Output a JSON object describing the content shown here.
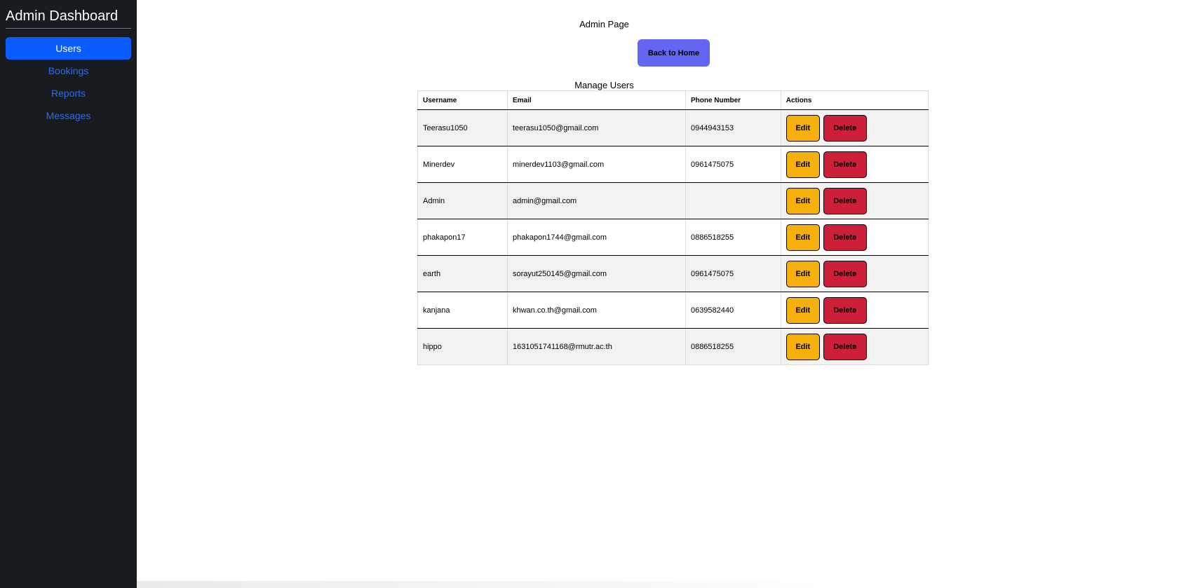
{
  "sidebar": {
    "title": "Admin Dashboard",
    "items": [
      {
        "label": "Users",
        "active": true
      },
      {
        "label": "Bookings",
        "active": false
      },
      {
        "label": "Reports",
        "active": false
      },
      {
        "label": "Messages",
        "active": false
      }
    ]
  },
  "main": {
    "page_title": "Admin Page",
    "back_button": "Back to Home",
    "section_title": "Manage Users",
    "table": {
      "headers": [
        "Username",
        "Email",
        "Phone Number",
        "Actions"
      ],
      "edit_label": "Edit",
      "delete_label": "Delete",
      "rows": [
        {
          "username": "Teerasu1050",
          "email": "teerasu1050@gmail.com",
          "phone": "0944943153"
        },
        {
          "username": "Minerdev",
          "email": "minerdev1103@gmail.com",
          "phone": "0961475075"
        },
        {
          "username": "Admin",
          "email": "admin@gmail.com",
          "phone": ""
        },
        {
          "username": "phakapon17",
          "email": "phakapon1744@gmail.com",
          "phone": "0886518255"
        },
        {
          "username": "earth",
          "email": "sorayut250145@gmail.com",
          "phone": "0961475075"
        },
        {
          "username": "kanjana",
          "email": "khwan.co.th@gmail.com",
          "phone": "0639582440"
        },
        {
          "username": "hippo",
          "email": "1631051741168@rmutr.ac.th",
          "phone": "0886518255"
        }
      ]
    }
  },
  "colors": {
    "sidebar_bg": "#181b1f",
    "nav_active": "#0b5cff",
    "nav_link": "#2a6bf2",
    "back_button": "#6366f1",
    "edit_button": "#f5b010",
    "delete_button": "#cc1f3a"
  }
}
